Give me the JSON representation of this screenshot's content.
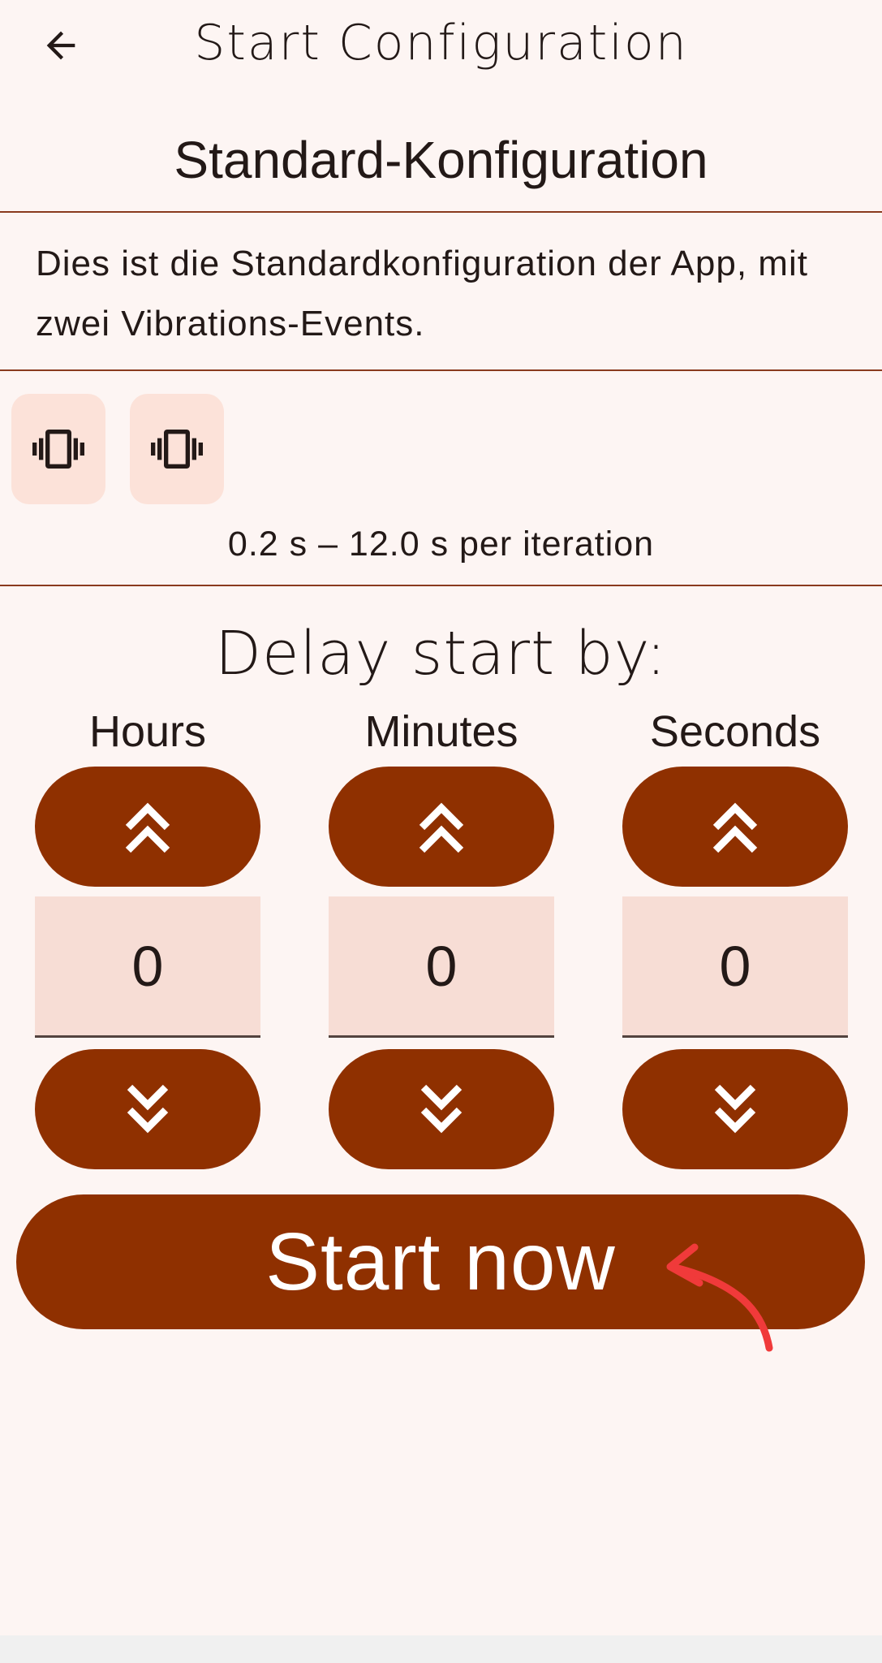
{
  "app_bar": {
    "title": "Start Configuration",
    "back_icon": "arrow-left-icon"
  },
  "config": {
    "name": "Standard-Konfiguration",
    "description": "Dies ist die Standardkonfiguration der App, mit zwei Vibrations-Events.",
    "events": [
      {
        "icon": "vibration-icon"
      },
      {
        "icon": "vibration-icon"
      }
    ],
    "iteration_text": "0.2 s – 12.0 s per iteration"
  },
  "delay": {
    "title": "Delay start by:",
    "columns": [
      {
        "label": "Hours",
        "value": "0"
      },
      {
        "label": "Minutes",
        "value": "0"
      },
      {
        "label": "Seconds",
        "value": "0"
      }
    ],
    "increase_icon": "double-chevron-up-icon",
    "decrease_icon": "double-chevron-down-icon"
  },
  "start_button": {
    "label": "Start now"
  },
  "colors": {
    "background": "#fdf5f3",
    "primary": "#8f3000",
    "chip": "#fce2d9",
    "field": "#f7ddd5",
    "divider": "#8a3a1e",
    "annotation_arrow": "#f03a3a"
  }
}
